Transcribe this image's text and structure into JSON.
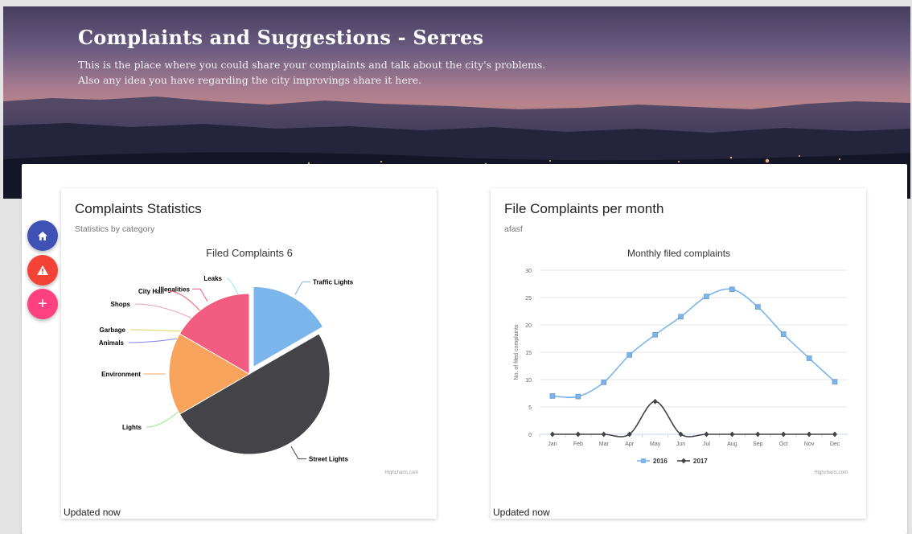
{
  "header": {
    "title": "Complaints and Suggestions - Serres",
    "line1": "This is the place where you could share your complaints and talk about the city's problems.",
    "line2": "Also any idea you have regarding the city improvings share it here."
  },
  "fabs": {
    "home_icon": "home-icon",
    "alert_icon": "warning-icon",
    "add_label": "+"
  },
  "cards": {
    "stats": {
      "title": "Complaints Statistics",
      "subtitle": "Statistics by category",
      "footer": "Updated now",
      "credits": "Highcharts.com"
    },
    "monthly": {
      "title": "File Complaints per month",
      "subtitle": "afasf",
      "footer": "Updated now",
      "credits": "Highcharts.com"
    }
  },
  "colors": {
    "series_2016": "#7cb5ec",
    "series_2017": "#434348",
    "environment": "#f7a35c",
    "illegalities": "#f15c80"
  },
  "chart_data": [
    {
      "type": "pie",
      "title": "Filed Complaints 6",
      "slices": [
        {
          "name": "Traffic Lights",
          "value": 1,
          "color": "#7cb5ec",
          "sliced": true
        },
        {
          "name": "Street Lights",
          "value": 3,
          "color": "#434348"
        },
        {
          "name": "Lights",
          "value": 0,
          "color": "#90ed7d"
        },
        {
          "name": "Environment",
          "value": 1,
          "color": "#f7a35c"
        },
        {
          "name": "Animals",
          "value": 0,
          "color": "#8085e9"
        },
        {
          "name": "Garbage",
          "value": 0,
          "color": "#e4d354"
        },
        {
          "name": "Illegalities",
          "value": 1,
          "color": "#f15c80"
        },
        {
          "name": "Shops",
          "value": 0,
          "color": "#e4a0b8"
        },
        {
          "name": "City Hall",
          "value": 0,
          "color": "#f45b5b"
        },
        {
          "name": "Leaks",
          "value": 0,
          "color": "#91e8e1"
        }
      ]
    },
    {
      "type": "line",
      "title": "Monthly filed complaints",
      "ylabel": "No. of filed complaints",
      "xlabel": "",
      "categories": [
        "Jan",
        "Feb",
        "Mar",
        "Apr",
        "May",
        "Jun",
        "Jul",
        "Aug",
        "Sep",
        "Oct",
        "Nov",
        "Dec"
      ],
      "ylim": [
        0,
        30
      ],
      "yticks": [
        0,
        5,
        10,
        15,
        20,
        25,
        30
      ],
      "grid": true,
      "legend": "bottom-center",
      "series": [
        {
          "name": "2016",
          "values": [
            7.0,
            6.9,
            9.5,
            14.5,
            18.2,
            21.5,
            25.2,
            26.5,
            23.3,
            18.3,
            13.9,
            9.6
          ],
          "color": "#7cb5ec",
          "marker": "square"
        },
        {
          "name": "2017",
          "values": [
            0,
            0,
            0,
            0,
            6,
            0,
            0,
            0,
            0,
            0,
            0,
            0
          ],
          "color": "#434348",
          "marker": "diamond"
        }
      ]
    }
  ]
}
